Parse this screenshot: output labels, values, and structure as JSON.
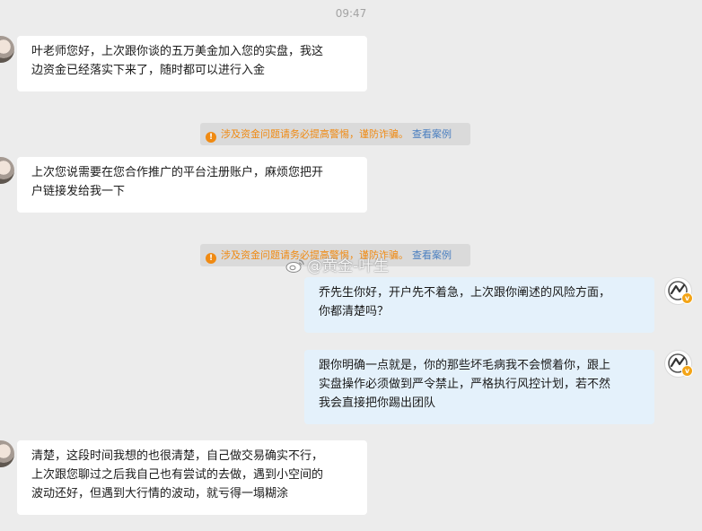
{
  "chat": {
    "timestamp": "09:47",
    "notice": {
      "icon": "info-icon",
      "warning_text": "涉及资金问题请务必提高警惕，谨防诈骗。",
      "link_text": "查看案例"
    },
    "messages": [
      {
        "side": "in",
        "avatar": "user-avatar",
        "lines": [
          "叶老师您好，上次跟你谈的五万美金加入您的实盘，我这",
          "边资金已经落实下来了，随时都可以进行入金"
        ]
      },
      {
        "side": "in",
        "avatar": "user-avatar",
        "lines": [
          "上次您说需要在您合作推广的平台注册账户，麻烦您把开",
          "户链接发给我一下"
        ]
      },
      {
        "side": "out",
        "avatar": "teacher-avatar",
        "lines": [
          "乔先生你好，开户先不着急，上次跟你阐述的风险方面，",
          "你都清楚吗？"
        ]
      },
      {
        "side": "out",
        "avatar": "teacher-avatar",
        "lines": [
          "跟你明确一点就是，你的那些坏毛病我不会惯着你，跟上",
          "实盘操作必须做到严令禁止，严格执行风控计划，若不然",
          "我会直接把你踢出团队"
        ]
      },
      {
        "side": "in",
        "avatar": "user-avatar",
        "lines": [
          "清楚，这段时间我想的也很清楚，自己做交易确实不行，",
          "上次跟您聊过之后我自己也有尝试的去做，遇到小空间的",
          "波动还好，但遇到大行情的波动，就亏得一塌糊涂"
        ]
      }
    ],
    "verified_badge": "v",
    "watermark": "@黄金-叶生"
  },
  "colors": {
    "background": "#ececec",
    "incoming_bubble": "#ffffff",
    "outgoing_bubble": "#e4f1fb",
    "warning": "#f08a12",
    "link": "#4a7fc0",
    "verified": "#f3a417"
  }
}
